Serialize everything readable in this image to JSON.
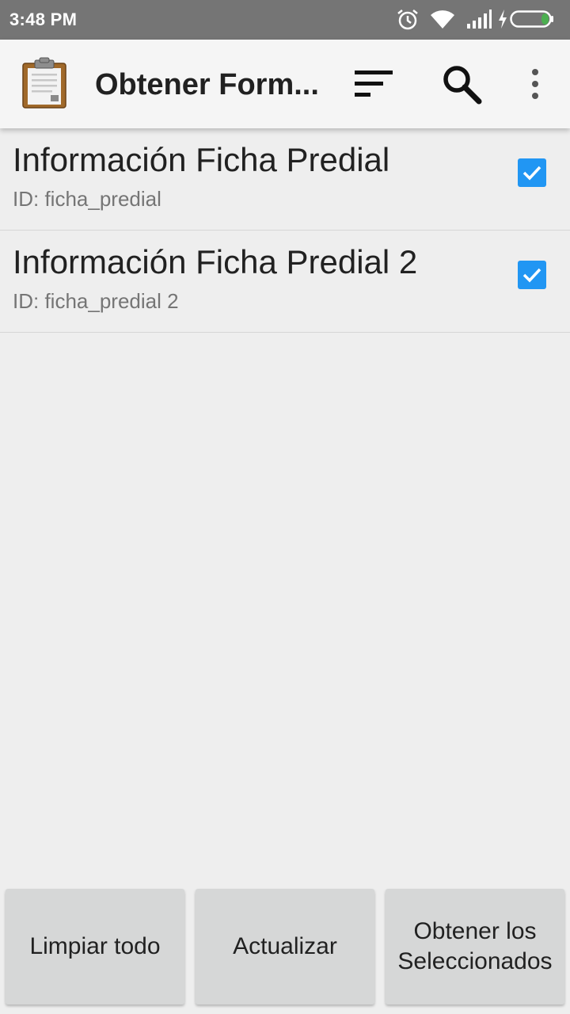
{
  "status_bar": {
    "time": "3:48 PM",
    "icons": [
      "alarm-icon",
      "wifi-icon",
      "signal-icon",
      "charging-icon",
      "battery-icon"
    ]
  },
  "app_bar": {
    "title": "Obtener Form...",
    "logo_icon": "clipboard-icon",
    "actions": [
      "sort-icon",
      "search-icon",
      "more-vert-icon"
    ]
  },
  "forms": [
    {
      "title": "Información Ficha Predial",
      "subtitle": "ID: ficha_predial",
      "checked": true
    },
    {
      "title": "Información Ficha Predial 2",
      "subtitle": "ID: ficha_predial 2",
      "checked": true
    }
  ],
  "buttons": {
    "clear_all": "Limpiar todo",
    "refresh": "Actualizar",
    "get_selected": "Obtener los Seleccionados"
  },
  "colors": {
    "checkbox": "#2196f3",
    "status_bar": "#757575",
    "battery_level": "#4caf50"
  }
}
